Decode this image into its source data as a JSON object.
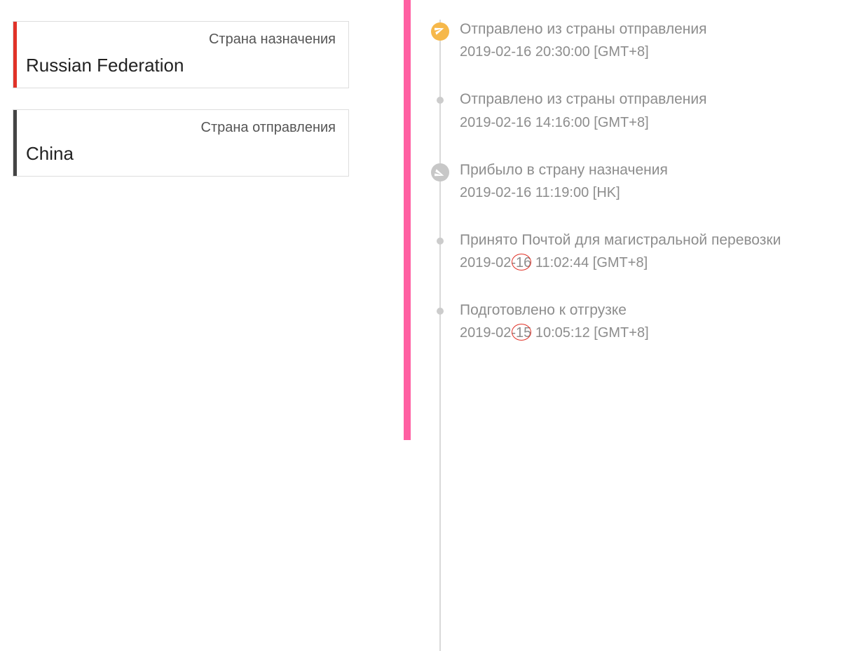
{
  "destination": {
    "label": "Страна назначения",
    "value": "Russian Federation"
  },
  "origin": {
    "label": "Страна отправления",
    "value": "China"
  },
  "timeline": [
    {
      "icon": "plane-up-icon",
      "title": "Отправлено из страны отправления",
      "date": "2019-02-16 20:30:00 [GMT+8]",
      "node_style": "orange",
      "highlight_day": null
    },
    {
      "icon": "dot-icon",
      "title": "Отправлено из страны отправления",
      "date": "2019-02-16 14:16:00 [GMT+8]",
      "node_style": "small",
      "highlight_day": null
    },
    {
      "icon": "plane-down-icon",
      "title": "Прибыло в страну назначения",
      "date": "2019-02-16 11:19:00 [HK]",
      "node_style": "grey-icon",
      "highlight_day": null
    },
    {
      "icon": "dot-icon",
      "title": "Принято Почтой для магистральной перевозки",
      "date": "2019-02-16 11:02:44 [GMT+8]",
      "node_style": "small",
      "highlight_day": "16"
    },
    {
      "icon": "dot-icon",
      "title": "Подготовлено к отгрузке",
      "date": "2019-02-15 10:05:12 [GMT+8]",
      "node_style": "small",
      "highlight_day": "15"
    }
  ]
}
